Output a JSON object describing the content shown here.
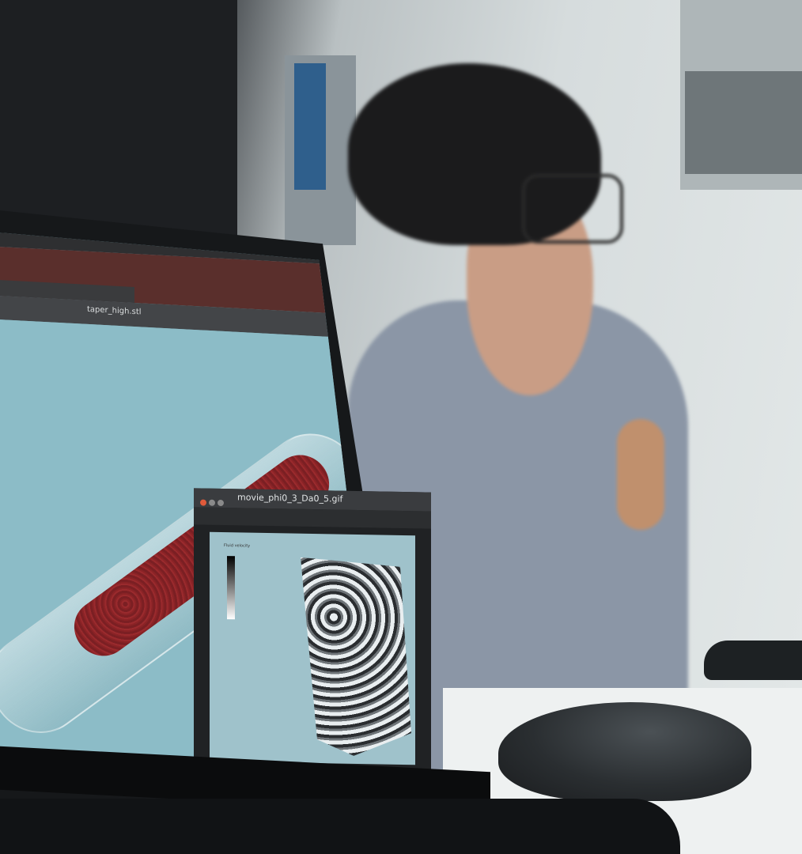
{
  "scene": {
    "type": "photo",
    "laptop_screen": {
      "main_window": {
        "document_title": "taper_high.stl"
      },
      "sub_window": {
        "title": "movie_phi0_3_Da0_5.gif",
        "colorbar_label": "Fluid velocity"
      }
    },
    "colors": {
      "viewport": "#8cbcc7",
      "particles": "#7b1f23",
      "title_strip": "#5a2f2c"
    }
  }
}
